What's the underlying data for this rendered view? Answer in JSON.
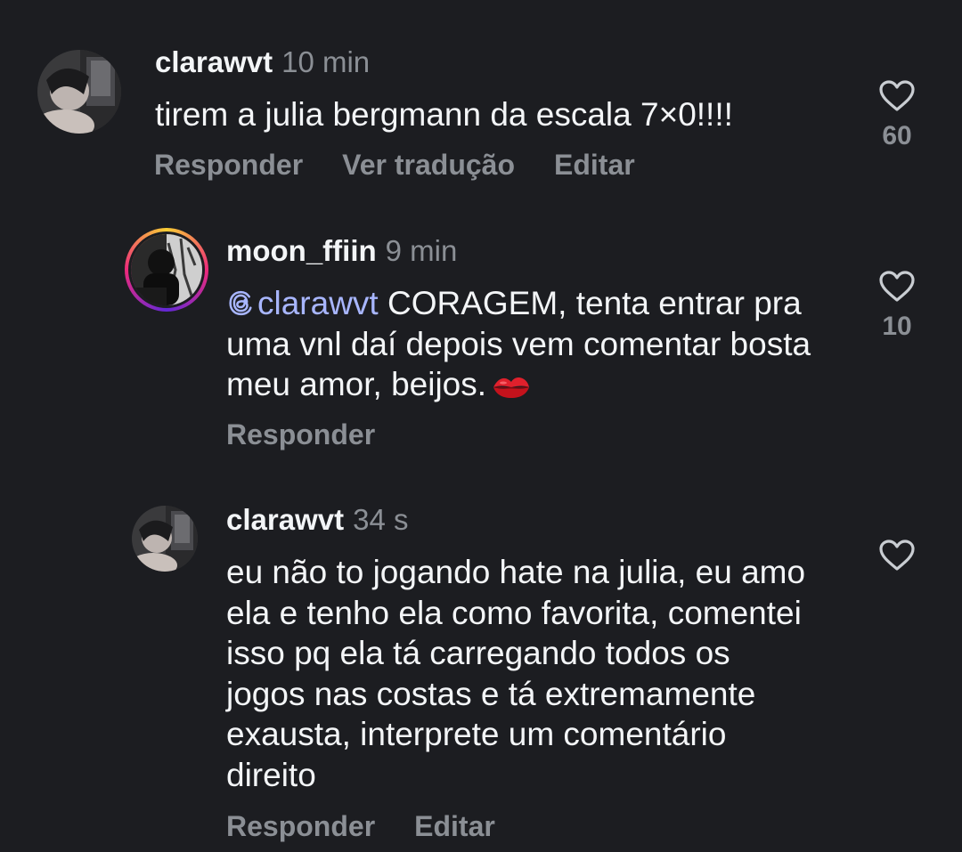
{
  "comments": [
    {
      "username": "clarawvt",
      "time": "10 min",
      "text": "tirem a julia bergmann da escala 7×0!!!!",
      "actions": [
        "Responder",
        "Ver tradução",
        "Editar"
      ],
      "likes": "60",
      "avatar_icon": "profile-photo"
    },
    {
      "username": "moon_ffiin",
      "time": "9 min",
      "mention": "clarawvt",
      "text_after_mention": " CORAGEM, tenta entrar pra uma vnl daí depois vem comentar bosta meu amor, beijos.",
      "emoji_icon": "kiss-mark-icon",
      "actions": [
        "Responder"
      ],
      "likes": "10",
      "avatar_icon": "profile-photo-story-ring"
    },
    {
      "username": "clarawvt",
      "time": "34 s",
      "text": "eu não to jogando hate na julia, eu amo ela e tenho ela como favorita, comentei isso pq ela tá carregando todos os jogos nas costas e tá extremamente exausta, interprete um comentário direito",
      "actions": [
        "Responder",
        "Editar"
      ],
      "likes": "",
      "avatar_icon": "profile-photo"
    }
  ],
  "colors": {
    "background": "#1c1d21",
    "text": "#f3f5f7",
    "secondary": "#8b8f95",
    "mention": "#a8b6ff"
  }
}
